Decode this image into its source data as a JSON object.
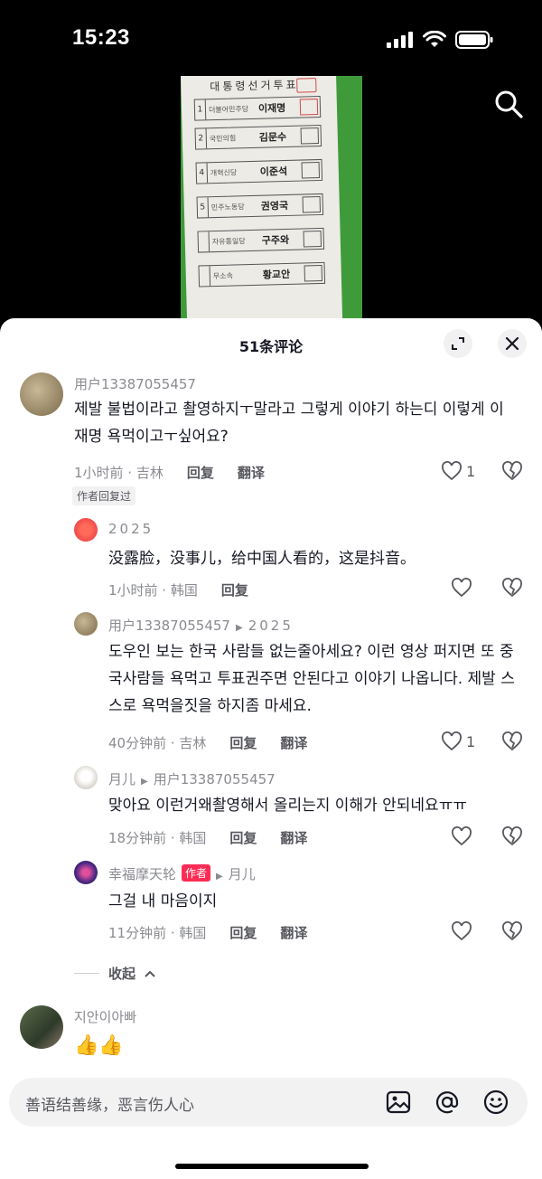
{
  "status_bar": {
    "time": "15:23"
  },
  "video": {
    "ballot_title": "대통령선거투표",
    "ballot_rows": [
      {
        "num": "1",
        "party": "더불어민주당",
        "name": "이재명"
      },
      {
        "num": "2",
        "party": "국민의힘",
        "name": "김문수"
      },
      {
        "num": "4",
        "party": "개혁신당",
        "name": "이준석"
      },
      {
        "num": "5",
        "party": "민주노동당",
        "name": "권영국"
      },
      {
        "num": "",
        "party": "자유통일당",
        "name": "구주와"
      },
      {
        "num": "",
        "party": "무소속",
        "name": "황교안"
      }
    ]
  },
  "comments_panel": {
    "title": "51条评论",
    "input_placeholder": "善语结善缘，恶言伤人心"
  },
  "comments": [
    {
      "user": "用户13387055457",
      "text": "제발 불법이라고 촬영하지ㅜ말라고 그렇게 이야기 하는디 이렇게 이재명 욕먹이고ㅜ싶어요?",
      "time_location": "1小时前 · 吉林",
      "reply": "回复",
      "translate": "翻译",
      "likes": "1",
      "badge": "作者回复过"
    },
    {
      "user": "2025",
      "text": "没露脸，没事儿，给中国人看的，这是抖音。",
      "time_location": "1小时前 · 韩国",
      "reply": "回复"
    },
    {
      "user": "用户13387055457",
      "reply_to": "2025",
      "text": "도우인 보는 한국 사람들 없는줄아세요? 이런 영상 퍼지면 또 중국사람들 욕먹고 투표권주면 안된다고 이야기 나옵니다. 제발 스스로 욕먹을짓을 하지좀 마세요.",
      "time_location": "40分钟前 · 吉林",
      "reply": "回复",
      "translate": "翻译",
      "likes": "1"
    },
    {
      "user": "月儿",
      "reply_to": "用户13387055457",
      "text": "맞아요 이런거왜촬영해서 올리는지 이해가 안되네요ㅠㅠ",
      "time_location": "18分钟前 · 韩国",
      "reply": "回复",
      "translate": "翻译"
    },
    {
      "user": "幸福摩天轮",
      "author_tag": "作者",
      "reply_to": "月儿",
      "text": "그걸 내 마음이지",
      "time_location": "11分钟前 · 韩国",
      "reply": "回复",
      "translate": "翻译"
    },
    {
      "user": "지안이아빠",
      "text": "👍👍"
    }
  ],
  "collapse_label": "收起",
  "colors": {
    "accent": "#fe2c55",
    "meta_gray": "#8a8b91",
    "video_bg": "#3f9b3a"
  }
}
